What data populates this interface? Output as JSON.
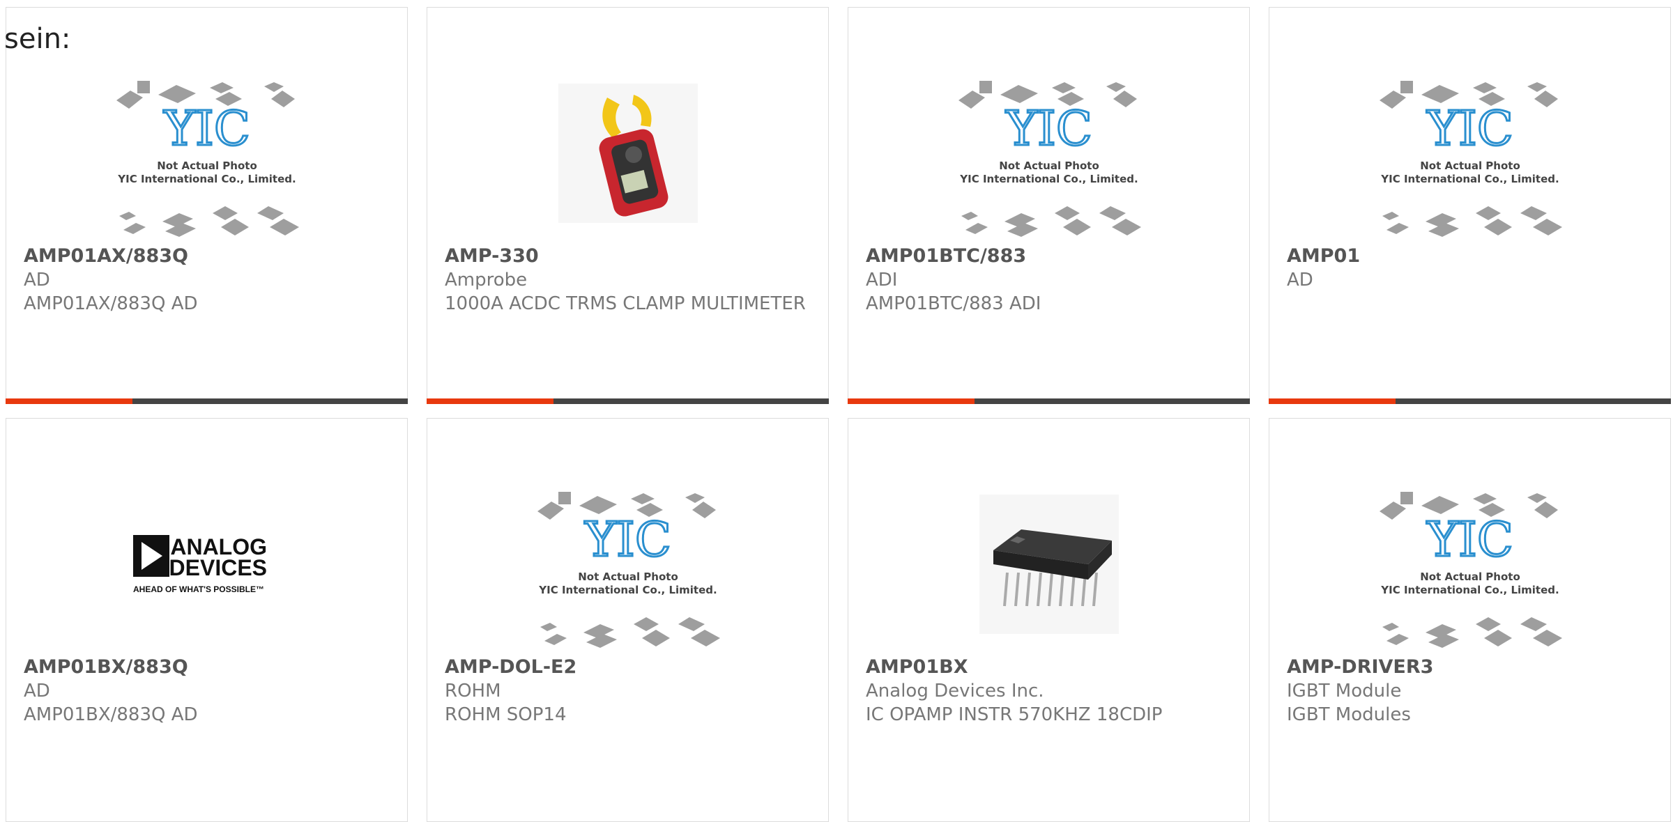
{
  "page": {
    "lead_text": "sein:"
  },
  "placeholder_caption": {
    "line1": "Not Actual Photo",
    "line2": "YIC International Co., Limited."
  },
  "brand_logo": {
    "line1": "ANALOG",
    "line2": "DEVICES",
    "tagline": "AHEAD OF WHAT'S POSSIBLE™"
  },
  "products": [
    {
      "part_number": "AMP01AX/883Q",
      "manufacturer": "AD",
      "description": "AMP01AX/883Q AD",
      "image": "yic-placeholder"
    },
    {
      "part_number": "AMP-330",
      "manufacturer": "Amprobe",
      "description": "1000A ACDC TRMS CLAMP MULTIMETER",
      "image": "clamp-meter"
    },
    {
      "part_number": "AMP01BTC/883",
      "manufacturer": "ADI",
      "description": "AMP01BTC/883 ADI",
      "image": "yic-placeholder"
    },
    {
      "part_number": "AMP01",
      "manufacturer": "AD",
      "description": "",
      "image": "yic-placeholder"
    },
    {
      "part_number": "AMP01BX/883Q",
      "manufacturer": "AD",
      "description": "AMP01BX/883Q AD",
      "image": "analog-devices-logo"
    },
    {
      "part_number": "AMP-DOL-E2",
      "manufacturer": "ROHM",
      "description": "ROHM SOP14",
      "image": "yic-placeholder"
    },
    {
      "part_number": "AMP01BX",
      "manufacturer": "Analog Devices Inc.",
      "description": "IC OPAMP INSTR 570KHZ 18CDIP",
      "image": "dip-chip"
    },
    {
      "part_number": "AMP-DRIVER3",
      "manufacturer": "IGBT Module",
      "description": "IGBT Modules",
      "image": "yic-placeholder"
    }
  ],
  "colors": {
    "accent": "#e8390e",
    "bar_dark": "#444444",
    "title_text": "#555555",
    "body_text": "#777777",
    "yic_blue": "#2a8fcf"
  }
}
